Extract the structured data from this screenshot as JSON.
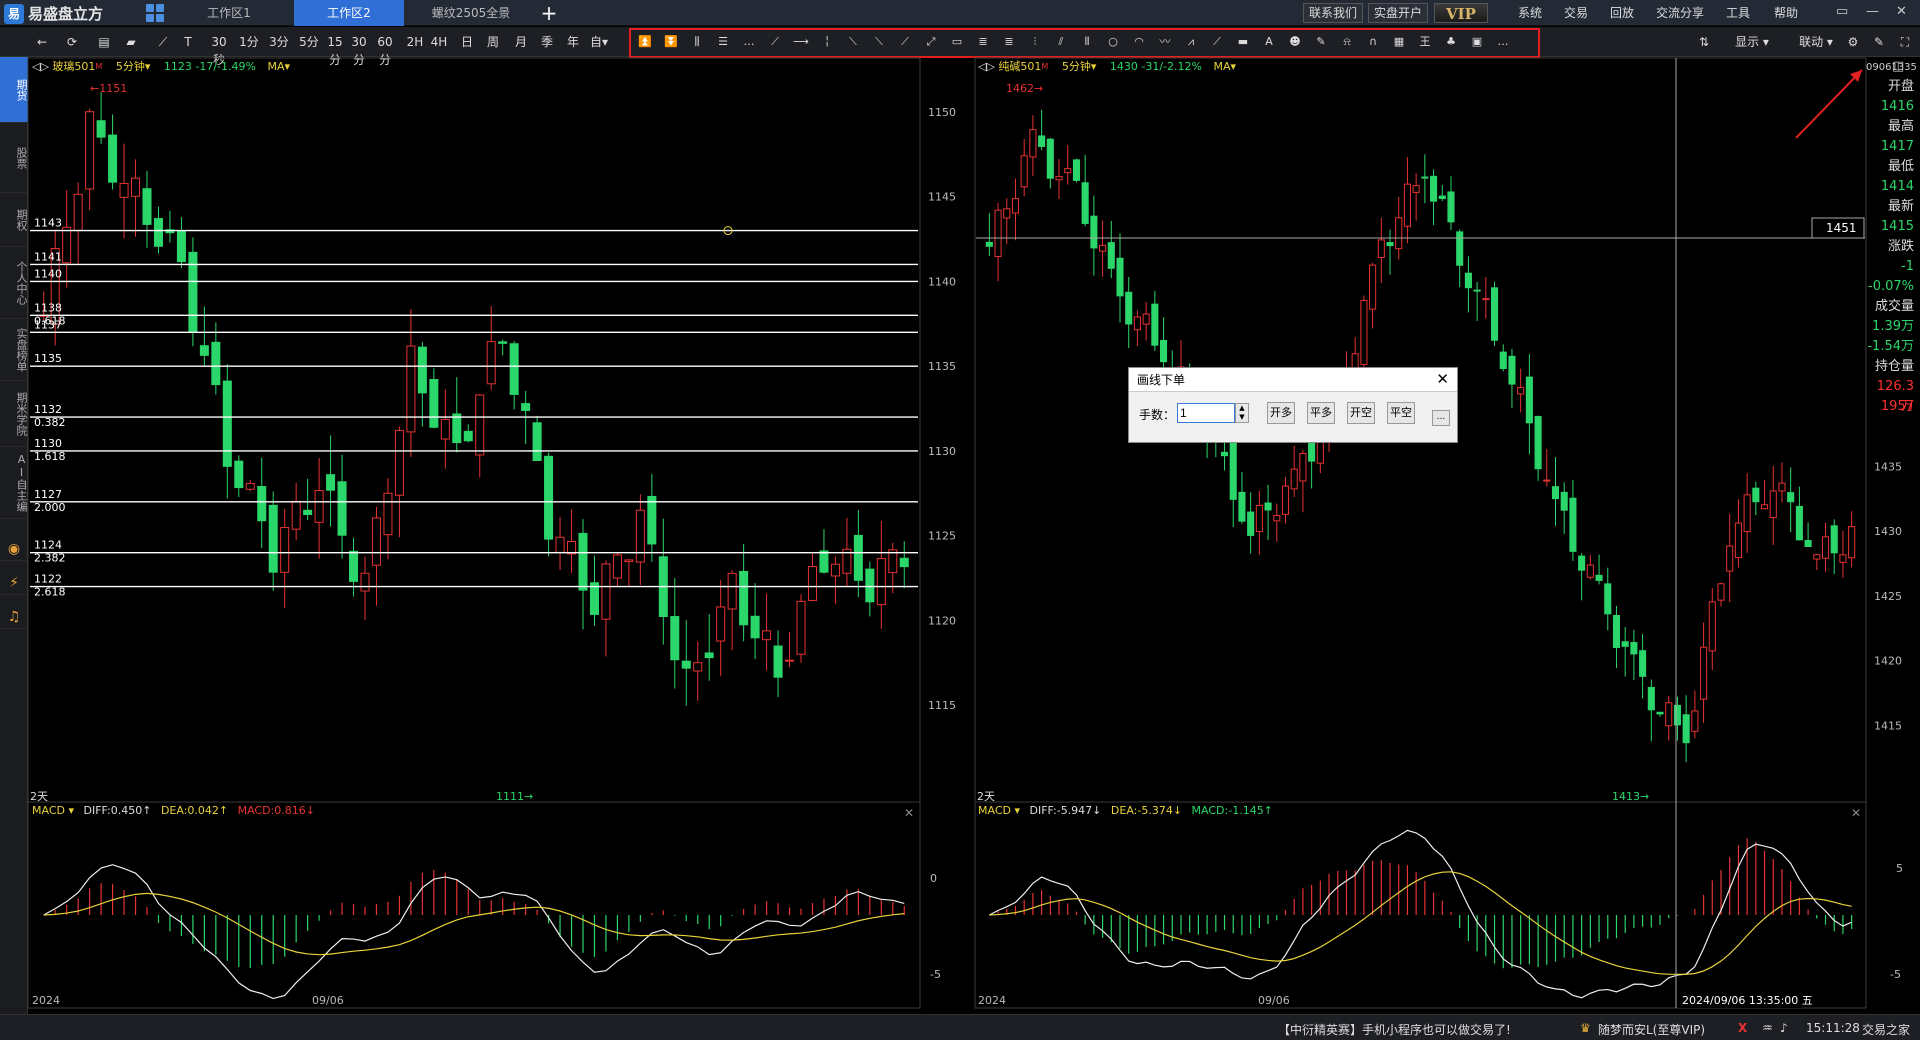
{
  "app": {
    "title": "易盛盘立方"
  },
  "tabs": [
    {
      "label": "工作区1",
      "active": false
    },
    {
      "label": "工作区2",
      "active": true
    },
    {
      "label": "螺纹2505全景",
      "active": false
    }
  ],
  "titlebar_right": {
    "contact": "联系我们",
    "open_account": "实盘开户",
    "vip": "VIP",
    "menus": [
      "系统",
      "交易",
      "回放",
      "交流分享",
      "工具",
      "帮助"
    ]
  },
  "toolbar": {
    "periods": [
      "30秒",
      "1分",
      "3分",
      "5分",
      "15分",
      "30分",
      "60分",
      "2H",
      "4H",
      "日",
      "周",
      "月",
      "季",
      "年",
      "自▾"
    ],
    "display_label": "显示 ▾",
    "link_label": "联动 ▾",
    "drawing_tools_count": 34
  },
  "leftnav": [
    "期货",
    "股票",
    "期权",
    "个人中心",
    "实盘榜单",
    "期米学院",
    "AI自主编"
  ],
  "chart_left": {
    "symbol": "玻璃501",
    "period": "5分钟",
    "price": "1123",
    "change": "-17/-1.49%",
    "indicator": "MA",
    "high_mark": "1151",
    "low_mark": "1111",
    "days_label": "2天",
    "ylabels": [
      "1150",
      "1145",
      "1140",
      "1135",
      "1130",
      "1125",
      "1120",
      "1115"
    ],
    "hlines": [
      {
        "p": "1143",
        "f": ""
      },
      {
        "p": "1141",
        "f": ""
      },
      {
        "p": "1140",
        "f": ""
      },
      {
        "p": "1138",
        "f": "0.618"
      },
      {
        "p": "1137",
        "f": ""
      },
      {
        "p": "1135",
        "f": ""
      },
      {
        "p": "1132",
        "f": "0.382"
      },
      {
        "p": "1130",
        "f": "1.618"
      },
      {
        "p": "1127",
        "f": "2.000"
      },
      {
        "p": "1124",
        "f": "2.382"
      },
      {
        "p": "1122",
        "f": "2.618"
      }
    ],
    "macd": {
      "name": "MACD",
      "diff": "DIFF:0.450↑",
      "dea": "DEA:0.042↑",
      "macd": "MACD:0.816↓",
      "yzero": "0",
      "ymin": "-5"
    },
    "date_year": "2024",
    "date_mid": "09/06"
  },
  "chart_right": {
    "symbol": "纯碱501",
    "period": "5分钟",
    "price": "1430",
    "change": "-31/-2.12%",
    "indicator": "MA",
    "high_mark": "1462",
    "low_mark": "1413",
    "days_label": "2天",
    "crosshair_price": "1451",
    "crosshair_time": "2024/09/06 13:35:00 五",
    "ylabels": [
      "1435",
      "1430",
      "1425",
      "1420",
      "1415"
    ],
    "macd": {
      "name": "MACD",
      "diff": "DIFF:-5.947↓",
      "dea": "DEA:-5.374↓",
      "macd": "MACD:-1.145↑",
      "ymax": "5",
      "ymin": "-5"
    },
    "date_year": "2024",
    "date_mid": "09/06"
  },
  "info_panel": {
    "id": "09061335",
    "rows": [
      {
        "k": "开盘",
        "v": "1416",
        "c": "#2bd66a"
      },
      {
        "k": "最高",
        "v": "1417",
        "c": "#2bd66a"
      },
      {
        "k": "最低",
        "v": "1414",
        "c": "#2bd66a"
      },
      {
        "k": "最新",
        "v": "1415",
        "c": "#2bd66a"
      },
      {
        "k": "涨跌",
        "v": "-1",
        "c": "#2bd66a"
      },
      {
        "k": "",
        "v": "-0.07%",
        "c": "#2bd66a"
      },
      {
        "k": "成交量",
        "v": "1.39万",
        "c": "#2bd66a"
      },
      {
        "k": "",
        "v": "-1.54万",
        "c": "#2bd66a"
      },
      {
        "k": "持仓量",
        "v": "126.3万",
        "c": "#ff3030"
      },
      {
        "k": "",
        "v": "1957",
        "c": "#ff3030"
      }
    ]
  },
  "dialog": {
    "title": "画线下单",
    "qty_label": "手数：",
    "qty_value": "1",
    "buttons": [
      "开多",
      "平多",
      "开空",
      "平空"
    ],
    "more": "..."
  },
  "statusbar": {
    "marquee": "【中衍精英赛】手机小程序也可以做交易了!",
    "user": "随梦而安L(至尊VIP)",
    "time": "15:11:28",
    "home": "交易之家"
  },
  "colors": {
    "up": "#e63232",
    "down": "#2bd66a",
    "accent": "#2f6fd6",
    "highlight": "#e02020"
  }
}
